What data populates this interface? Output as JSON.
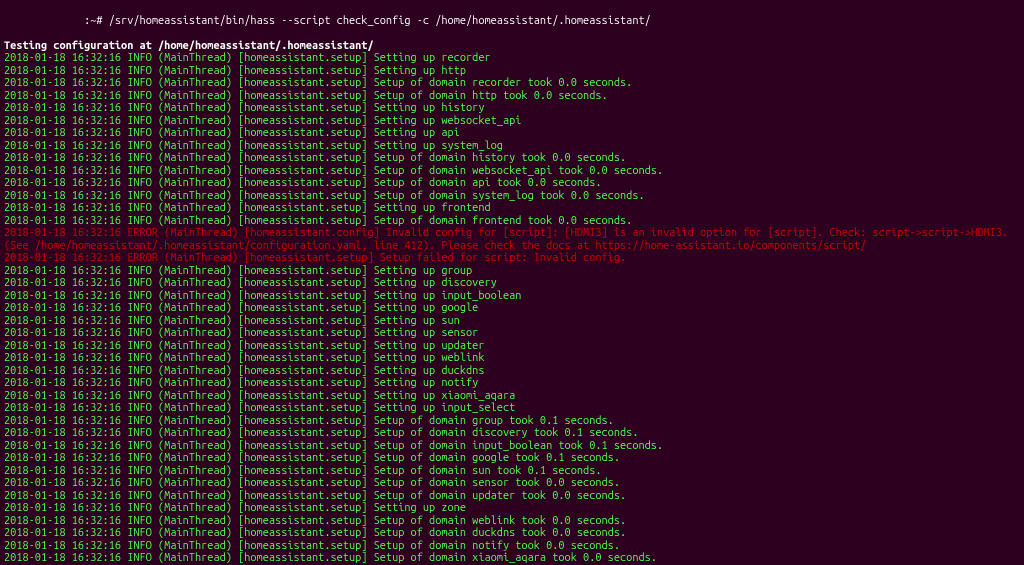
{
  "prompt": {
    "prefix": "         :~# ",
    "command": "/srv/homeassistant/bin/hass --script check_config -c /home/homeassistant/.homeassistant/"
  },
  "testing_line": "Testing configuration at /home/homeassistant/.homeassistant/",
  "lines": [
    {
      "type": "info",
      "text": "2018-01-18 16:32:16 INFO (MainThread) [homeassistant.setup] Setting up recorder"
    },
    {
      "type": "info",
      "text": "2018-01-18 16:32:16 INFO (MainThread) [homeassistant.setup] Setting up http"
    },
    {
      "type": "info",
      "text": "2018-01-18 16:32:16 INFO (MainThread) [homeassistant.setup] Setup of domain recorder took 0.0 seconds."
    },
    {
      "type": "info",
      "text": "2018-01-18 16:32:16 INFO (MainThread) [homeassistant.setup] Setup of domain http took 0.0 seconds."
    },
    {
      "type": "info",
      "text": "2018-01-18 16:32:16 INFO (MainThread) [homeassistant.setup] Setting up history"
    },
    {
      "type": "info",
      "text": "2018-01-18 16:32:16 INFO (MainThread) [homeassistant.setup] Setting up websocket_api"
    },
    {
      "type": "info",
      "text": "2018-01-18 16:32:16 INFO (MainThread) [homeassistant.setup] Setting up api"
    },
    {
      "type": "info",
      "text": "2018-01-18 16:32:16 INFO (MainThread) [homeassistant.setup] Setting up system_log"
    },
    {
      "type": "info",
      "text": "2018-01-18 16:32:16 INFO (MainThread) [homeassistant.setup] Setup of domain history took 0.0 seconds."
    },
    {
      "type": "info",
      "text": "2018-01-18 16:32:16 INFO (MainThread) [homeassistant.setup] Setup of domain websocket_api took 0.0 seconds."
    },
    {
      "type": "info",
      "text": "2018-01-18 16:32:16 INFO (MainThread) [homeassistant.setup] Setup of domain api took 0.0 seconds."
    },
    {
      "type": "info",
      "text": "2018-01-18 16:32:16 INFO (MainThread) [homeassistant.setup] Setup of domain system_log took 0.0 seconds."
    },
    {
      "type": "info",
      "text": "2018-01-18 16:32:16 INFO (MainThread) [homeassistant.setup] Setting up frontend"
    },
    {
      "type": "info",
      "text": "2018-01-18 16:32:16 INFO (MainThread) [homeassistant.setup] Setup of domain frontend took 0.0 seconds."
    },
    {
      "type": "error",
      "text": "2018-01-18 16:32:16 ERROR (MainThread) [homeassistant.config] Invalid config for [script]: [HDMI3] is an invalid option for [script]. Check: script->script->HDMI3. (See /home/homeassistant/.homeassistant/configuration.yaml, line 412). Please check the docs at https://home-assistant.io/components/script/"
    },
    {
      "type": "error",
      "text": "2018-01-18 16:32:16 ERROR (MainThread) [homeassistant.setup] Setup failed for script: Invalid config."
    },
    {
      "type": "info",
      "text": "2018-01-18 16:32:16 INFO (MainThread) [homeassistant.setup] Setting up group"
    },
    {
      "type": "info",
      "text": "2018-01-18 16:32:16 INFO (MainThread) [homeassistant.setup] Setting up discovery"
    },
    {
      "type": "info",
      "text": "2018-01-18 16:32:16 INFO (MainThread) [homeassistant.setup] Setting up input_boolean"
    },
    {
      "type": "info",
      "text": "2018-01-18 16:32:16 INFO (MainThread) [homeassistant.setup] Setting up google"
    },
    {
      "type": "info",
      "text": "2018-01-18 16:32:16 INFO (MainThread) [homeassistant.setup] Setting up sun"
    },
    {
      "type": "info",
      "text": "2018-01-18 16:32:16 INFO (MainThread) [homeassistant.setup] Setting up sensor"
    },
    {
      "type": "info",
      "text": "2018-01-18 16:32:16 INFO (MainThread) [homeassistant.setup] Setting up updater"
    },
    {
      "type": "info",
      "text": "2018-01-18 16:32:16 INFO (MainThread) [homeassistant.setup] Setting up weblink"
    },
    {
      "type": "info",
      "text": "2018-01-18 16:32:16 INFO (MainThread) [homeassistant.setup] Setting up duckdns"
    },
    {
      "type": "info",
      "text": "2018-01-18 16:32:16 INFO (MainThread) [homeassistant.setup] Setting up notify"
    },
    {
      "type": "info",
      "text": "2018-01-18 16:32:16 INFO (MainThread) [homeassistant.setup] Setting up xiaomi_aqara"
    },
    {
      "type": "info",
      "text": "2018-01-18 16:32:16 INFO (MainThread) [homeassistant.setup] Setting up input_select"
    },
    {
      "type": "info",
      "text": "2018-01-18 16:32:16 INFO (MainThread) [homeassistant.setup] Setup of domain group took 0.1 seconds."
    },
    {
      "type": "info",
      "text": "2018-01-18 16:32:16 INFO (MainThread) [homeassistant.setup] Setup of domain discovery took 0.1 seconds."
    },
    {
      "type": "info",
      "text": "2018-01-18 16:32:16 INFO (MainThread) [homeassistant.setup] Setup of domain input_boolean took 0.1 seconds."
    },
    {
      "type": "info",
      "text": "2018-01-18 16:32:16 INFO (MainThread) [homeassistant.setup] Setup of domain google took 0.1 seconds."
    },
    {
      "type": "info",
      "text": "2018-01-18 16:32:16 INFO (MainThread) [homeassistant.setup] Setup of domain sun took 0.1 seconds."
    },
    {
      "type": "info",
      "text": "2018-01-18 16:32:16 INFO (MainThread) [homeassistant.setup] Setup of domain sensor took 0.0 seconds."
    },
    {
      "type": "info",
      "text": "2018-01-18 16:32:16 INFO (MainThread) [homeassistant.setup] Setup of domain updater took 0.0 seconds."
    },
    {
      "type": "info",
      "text": "2018-01-18 16:32:16 INFO (MainThread) [homeassistant.setup] Setting up zone"
    },
    {
      "type": "info",
      "text": "2018-01-18 16:32:16 INFO (MainThread) [homeassistant.setup] Setup of domain weblink took 0.0 seconds."
    },
    {
      "type": "info",
      "text": "2018-01-18 16:32:16 INFO (MainThread) [homeassistant.setup] Setup of domain duckdns took 0.0 seconds."
    },
    {
      "type": "info",
      "text": "2018-01-18 16:32:16 INFO (MainThread) [homeassistant.setup] Setup of domain notify took 0.0 seconds."
    },
    {
      "type": "info",
      "text": "2018-01-18 16:32:16 INFO (MainThread) [homeassistant.setup] Setup of domain xiaomi_aqara took 0.0 seconds."
    }
  ]
}
